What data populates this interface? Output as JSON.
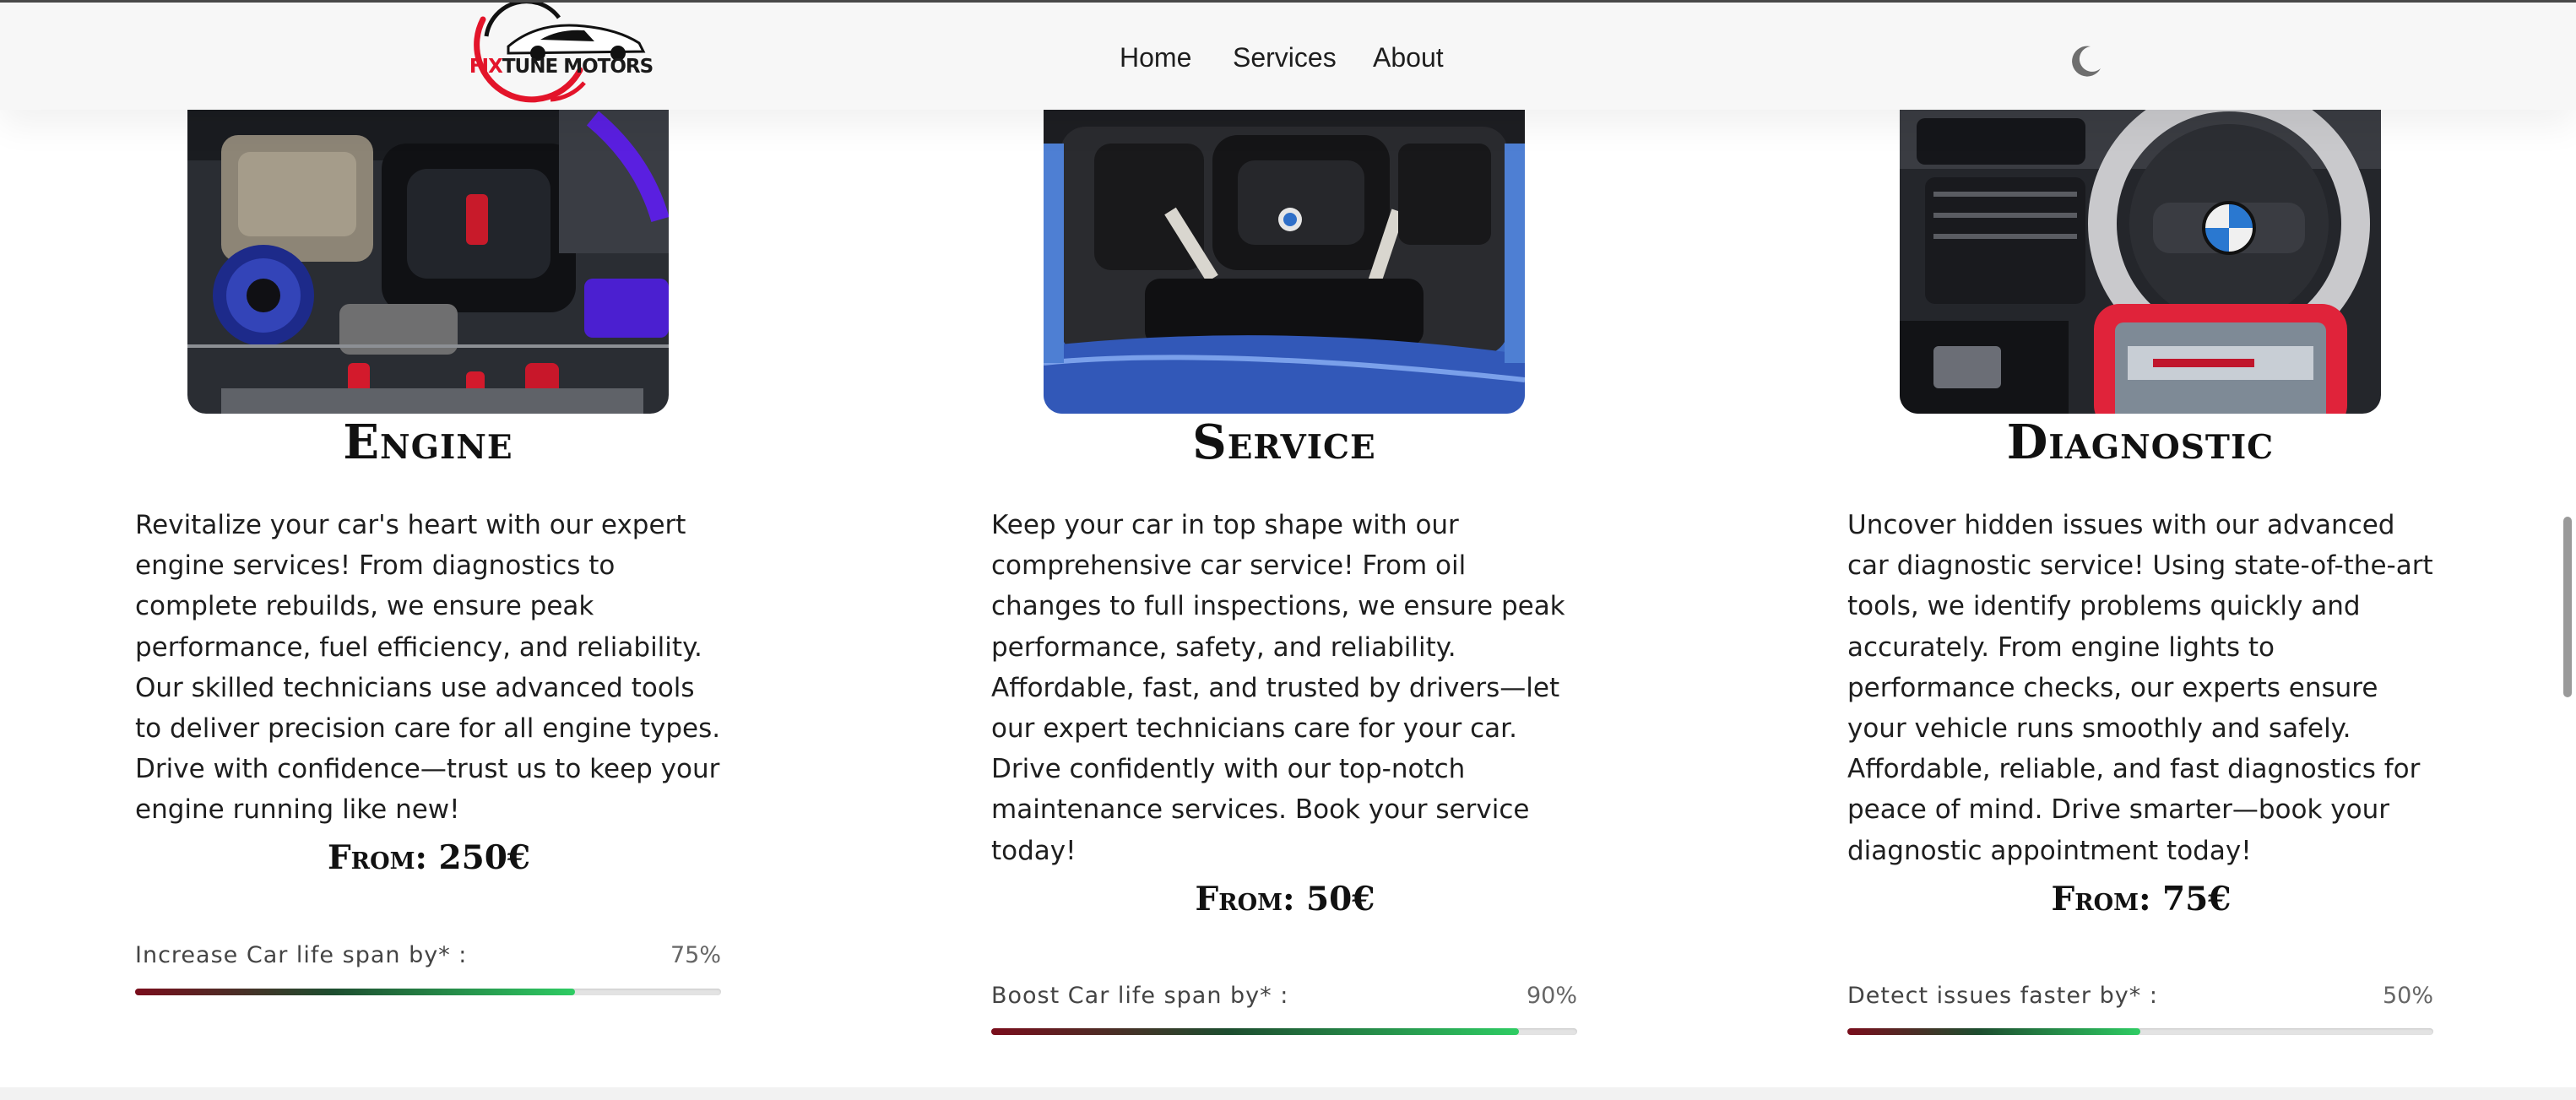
{
  "brand": {
    "logo_text_red": "FIX",
    "logo_text_dark": "TUNE MOTORS",
    "accent": "#e3142a"
  },
  "nav": {
    "home": "Home",
    "services": "Services",
    "about": "About",
    "theme_icon": "moon-icon"
  },
  "cards": [
    {
      "title": "Engine",
      "image": "engine-bay-photo",
      "description": "Revitalize your car's heart with our expert engine services! From diagnostics to complete rebuilds, we ensure peak performance, fuel efficiency, and reliability. Our skilled technicians use advanced tools to deliver precision care for all engine types. Drive with confidence—trust us to keep your engine running like new!",
      "price": "From: 250€",
      "bar_label": "Increase Car life span by* :",
      "bar_text": "75%",
      "bar_value": 0.75
    },
    {
      "title": "Service",
      "image": "bmw-engine-photo",
      "description": "Keep your car in top shape with our comprehensive car service! From oil changes to full inspections, we ensure peak performance, safety, and reliability. Affordable, fast, and trusted by drivers—let our expert technicians care for your car. Drive confidently with our top-notch maintenance services. Book your service today!",
      "price": "From: 50€",
      "bar_label": "Boost Car life span by* :",
      "bar_text": "90%",
      "bar_value": 0.9
    },
    {
      "title": "Diagnostic",
      "image": "diagnostic-tablet-photo",
      "description": "Uncover hidden issues with our advanced car diagnostic service! Using state-of-the-art tools, we identify problems quickly and accurately. From engine lights to performance checks, our experts ensure your vehicle runs smoothly and safely. Affordable, reliable, and fast diagnostics for peace of mind. Drive smarter—book your diagnostic appointment today!",
      "price": "From: 75€",
      "bar_label": "Detect issues faster by* :",
      "bar_text": "50%",
      "bar_value": 0.5
    }
  ],
  "colors": {
    "bar_start": "#7a0d1c",
    "bar_mid": "#1d4d2f",
    "bar_end": "#2ecc63",
    "track": "#e3e3e3"
  }
}
